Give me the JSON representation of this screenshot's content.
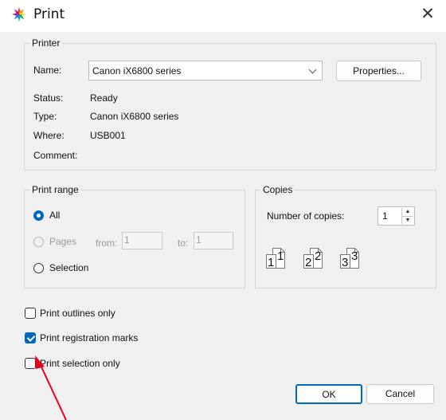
{
  "window": {
    "title": "Print",
    "close_glyph": "✕"
  },
  "printer": {
    "legend": "Printer",
    "name_label": "Name:",
    "name_value": "Canon iX6800 series",
    "properties_label": "Properties...",
    "status_label": "Status:",
    "status_value": "Ready",
    "type_label": "Type:",
    "type_value": "Canon iX6800 series",
    "where_label": "Where:",
    "where_value": "USB001",
    "comment_label": "Comment:"
  },
  "print_range": {
    "legend": "Print range",
    "all_label": "All",
    "pages_label": "Pages",
    "from_label": "from:",
    "from_value": "1",
    "to_label": "to:",
    "to_value": "1",
    "selection_label": "Selection",
    "selected": "All"
  },
  "copies": {
    "legend": "Copies",
    "number_label": "Number of copies:",
    "number_value": "1",
    "collate_numbers": [
      "1",
      "1",
      "2",
      "2",
      "3",
      "3"
    ]
  },
  "options": {
    "outlines_label": "Print outlines only",
    "outlines_checked": false,
    "registration_label": "Print registration marks",
    "registration_checked": true,
    "selection_only_label": "Print selection only",
    "selection_only_checked": false
  },
  "buttons": {
    "ok_label": "OK",
    "cancel_label": "Cancel"
  },
  "annotation": {
    "arrow_color": "#e8001c"
  },
  "colors": {
    "accent": "#0067c0"
  }
}
